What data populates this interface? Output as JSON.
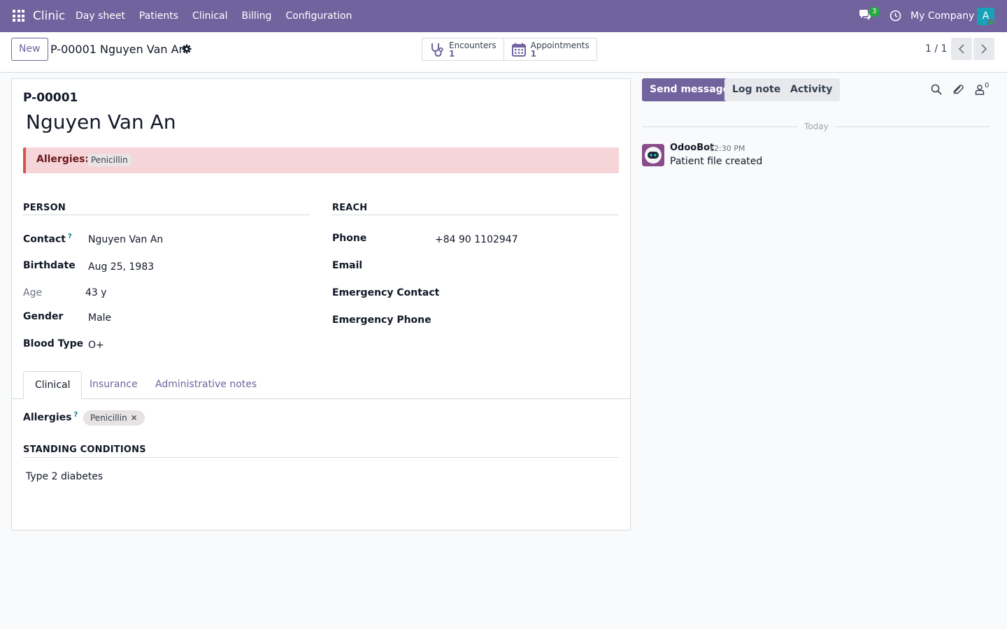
{
  "navbar": {
    "brand": "Clinic",
    "menu": [
      "Day sheet",
      "Patients",
      "Clinical",
      "Billing",
      "Configuration"
    ],
    "messages_badge": "3",
    "company": "My Company",
    "avatar_letter": "A"
  },
  "control": {
    "new_label": "New",
    "breadcrumb": "P-00001 Nguyen Van An",
    "smart_buttons": [
      {
        "label": "Encounters",
        "count": "1",
        "icon": "stethoscope-icon"
      },
      {
        "label": "Appointments",
        "count": "1",
        "icon": "calendar-icon"
      }
    ],
    "pager": "1 / 1"
  },
  "form": {
    "ref": "P-00001",
    "name": "Nguyen Van An",
    "alert": {
      "label": "Allergies:",
      "tag": "Penicillin"
    },
    "person": {
      "title": "PERSON",
      "contact_label": "Contact",
      "contact_help": "?",
      "contact": "Nguyen Van An",
      "birthdate_label": "Birthdate",
      "birthdate": "Aug 25, 1983",
      "age_label": "Age",
      "age": "43 y",
      "gender_label": "Gender",
      "gender": "Male",
      "blood_label": "Blood Type",
      "blood": "O+"
    },
    "reach": {
      "title": "REACH",
      "phone_label": "Phone",
      "phone": "+84 90 1102947",
      "email_label": "Email",
      "emergency_contact_label": "Emergency Contact",
      "emergency_phone_label": "Emergency Phone"
    },
    "tabs": [
      "Clinical",
      "Insurance",
      "Administrative notes"
    ],
    "clinical": {
      "allergies_label": "Allergies",
      "allergies_help": "?",
      "allergy_chip": "Penicillin",
      "chip_remove": "✕",
      "standing_title": "STANDING CONDITIONS",
      "standing_value": "Type 2 diabetes"
    }
  },
  "chatter": {
    "send_message": "Send message",
    "log_note": "Log note",
    "activity": "Activity",
    "followers_count": "0",
    "date_separator": "Today",
    "messages": [
      {
        "author": "OdooBot",
        "time": "12:30 PM",
        "body": "Patient file created"
      }
    ]
  }
}
